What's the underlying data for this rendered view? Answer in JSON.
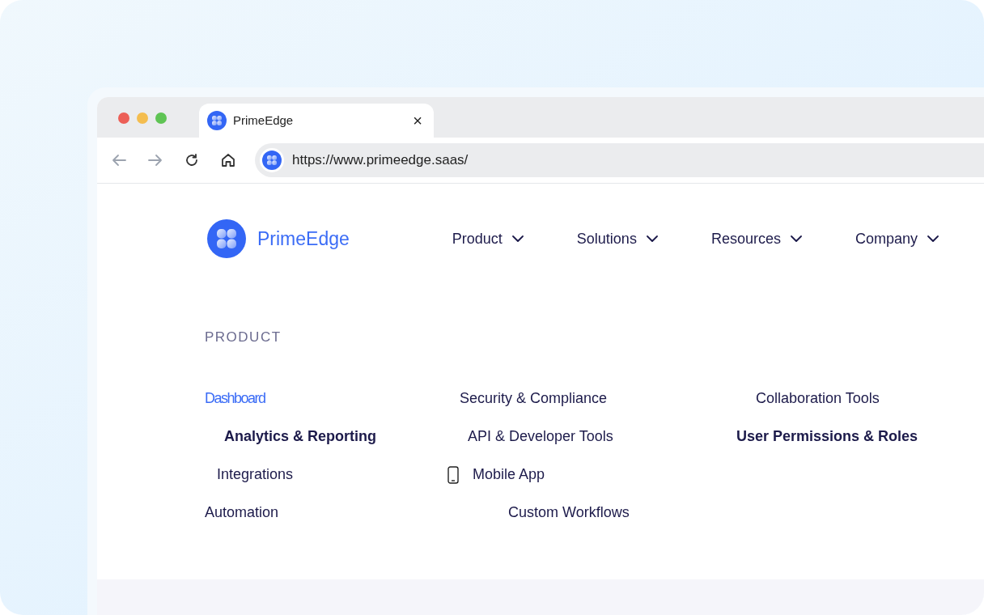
{
  "browser": {
    "tab_title": "PrimeEdge",
    "tab_close": "×",
    "url": "https://www.primeedge.saas/"
  },
  "header": {
    "brand": "PrimeEdge",
    "nav": [
      {
        "label": "Product"
      },
      {
        "label": "Solutions"
      },
      {
        "label": "Resources"
      },
      {
        "label": "Company"
      }
    ]
  },
  "menu": {
    "heading": "PRODUCT",
    "columns": [
      [
        {
          "label": "Dashboard",
          "kind": "plain",
          "selected": true,
          "bold": false
        },
        {
          "label": "Analytics & Reporting",
          "kind": "plain",
          "selected": false,
          "bold": true
        },
        {
          "label": "Integrations",
          "kind": "plain",
          "selected": false,
          "bold": false
        },
        {
          "label": "Automation",
          "kind": "plain",
          "selected": false,
          "bold": false
        }
      ],
      [
        {
          "label": "Security & Compliance",
          "kind": "plain",
          "selected": false,
          "bold": false
        },
        {
          "label": "API & Developer Tools",
          "kind": "plain",
          "selected": false,
          "bold": false
        },
        {
          "label": "Mobile App",
          "kind": "phone",
          "selected": false,
          "bold": false
        },
        {
          "label": "Custom Workflows",
          "kind": "plain",
          "selected": false,
          "bold": false
        }
      ],
      [
        {
          "label": "Collaboration Tools",
          "kind": "plain",
          "selected": false,
          "bold": false
        },
        {
          "label": "User Permissions & Roles",
          "kind": "plain",
          "selected": false,
          "bold": true
        }
      ]
    ]
  }
}
